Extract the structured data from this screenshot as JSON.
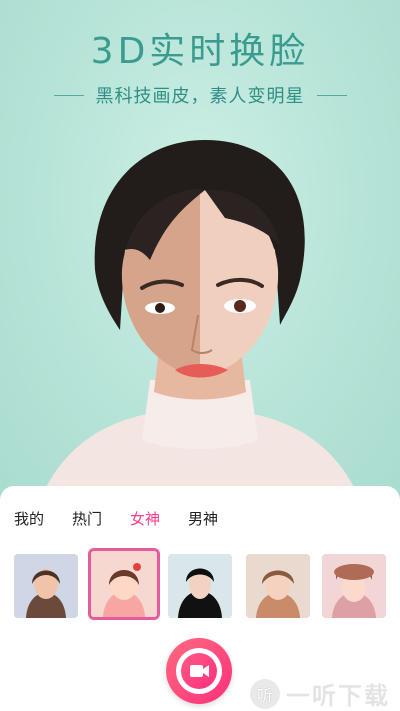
{
  "header": {
    "title": "3D实时换脸",
    "subtitle": "黑科技画皮，素人变明星"
  },
  "tabs": [
    {
      "label": "我的",
      "active": false
    },
    {
      "label": "热门",
      "active": false
    },
    {
      "label": "女神",
      "active": true
    },
    {
      "label": "男神",
      "active": false
    }
  ],
  "thumbnails": [
    {
      "name": "portrait-1",
      "active": false
    },
    {
      "name": "portrait-2",
      "active": true
    },
    {
      "name": "portrait-3",
      "active": false
    },
    {
      "name": "portrait-4",
      "active": false
    },
    {
      "name": "portrait-5",
      "active": false
    }
  ],
  "record": {
    "icon": "video-camera-icon"
  },
  "watermark": {
    "badge": "听",
    "text": "一听下载"
  },
  "colors": {
    "accent": "#ff3c8e",
    "title": "#3a9b8f",
    "background": "#b9e6da"
  }
}
